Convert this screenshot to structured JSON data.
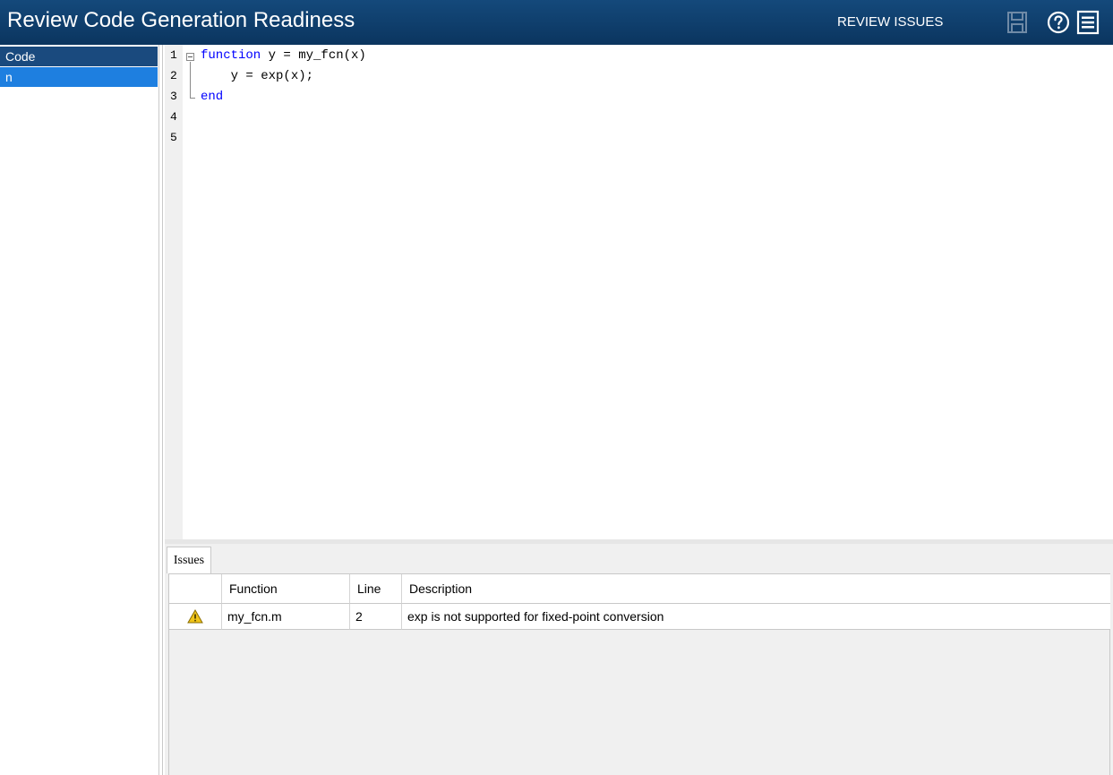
{
  "header": {
    "title": "Review Code Generation Readiness",
    "action_label": "REVIEW ISSUES",
    "icons": [
      "save-icon",
      "help-icon",
      "menu-icon"
    ]
  },
  "tree": {
    "items": [
      {
        "label": "Code",
        "selected": false
      },
      {
        "label": "n",
        "selected": true
      }
    ]
  },
  "editor": {
    "line_numbers": [
      "1",
      "2",
      "3",
      "4",
      "5"
    ],
    "lines": [
      {
        "keyword": "function",
        "text": " y = my_fcn(x)"
      },
      {
        "keyword": "",
        "text": "    y = exp(x);"
      },
      {
        "keyword": "end",
        "text": ""
      }
    ]
  },
  "issues": {
    "tab_label": "Issues",
    "columns": [
      "",
      "Function",
      "Line",
      "Description"
    ],
    "rows": [
      {
        "icon": "warning-icon",
        "function": "my_fcn.m",
        "line": "2",
        "description": "exp is not supported for fixed-point conversion"
      }
    ]
  },
  "colors": {
    "title_bar": "#0f3a66",
    "tree_selected": "#1e7fe0",
    "keyword": "#0000ff",
    "warning": "#f0c419"
  }
}
